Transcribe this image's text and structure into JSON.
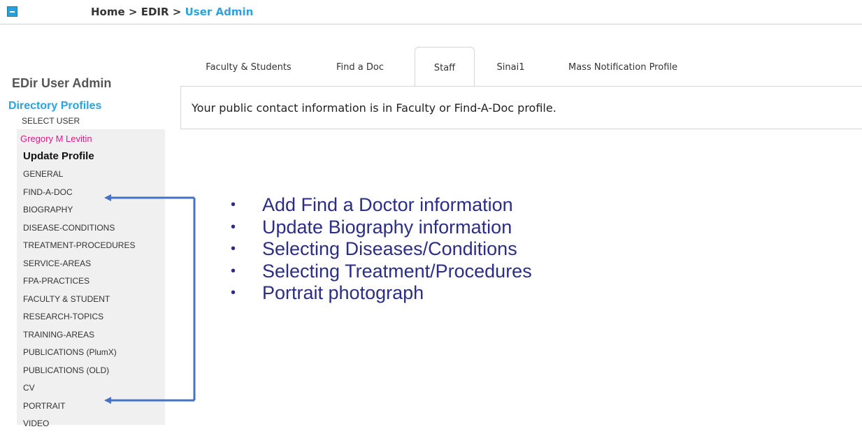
{
  "header": {
    "breadcrumb": [
      "Home",
      ">",
      "EDIR",
      ">",
      "User Admin"
    ]
  },
  "sidebar": {
    "app_title": "EDir User Admin",
    "section_title": "Directory Profiles",
    "select_user": "SELECT USER",
    "user_name": "Gregory M Levitin",
    "update_profile": "Update Profile",
    "items": [
      "GENERAL",
      "FIND-A-DOC",
      "BIOGRAPHY",
      "DISEASE-CONDITIONS",
      "TREATMENT-PROCEDURES",
      "SERVICE-AREAS",
      "FPA-PRACTICES",
      "FACULTY & STUDENT",
      "RESEARCH-TOPICS",
      "TRAINING-AREAS",
      "PUBLICATIONS (PlumX)",
      "PUBLICATIONS (OLD)",
      "CV",
      "PORTRAIT",
      "VIDEO"
    ]
  },
  "tabs": [
    {
      "label": "Faculty & Students"
    },
    {
      "label": "Find a Doc"
    },
    {
      "label": "Staff",
      "active": true
    },
    {
      "label": "Sinai1"
    },
    {
      "label": "Mass Notification Profile"
    }
  ],
  "content": {
    "message": "Your public contact information is in Faculty or Find-A-Doc profile."
  },
  "annotation": {
    "bullets": [
      "Add Find a Doctor information",
      "Update Biography information",
      "Selecting Diseases/Conditions",
      "Selecting Treatment/Procedures",
      "Portrait photograph"
    ],
    "bullet_glyph": "•",
    "colors": {
      "text": "#2b2d86",
      "connector": "#4472c4"
    }
  },
  "colors": {
    "accent": "#2aa3e0",
    "user_name": "#d81b8a",
    "sidebar_bg": "#f0f0f0"
  }
}
